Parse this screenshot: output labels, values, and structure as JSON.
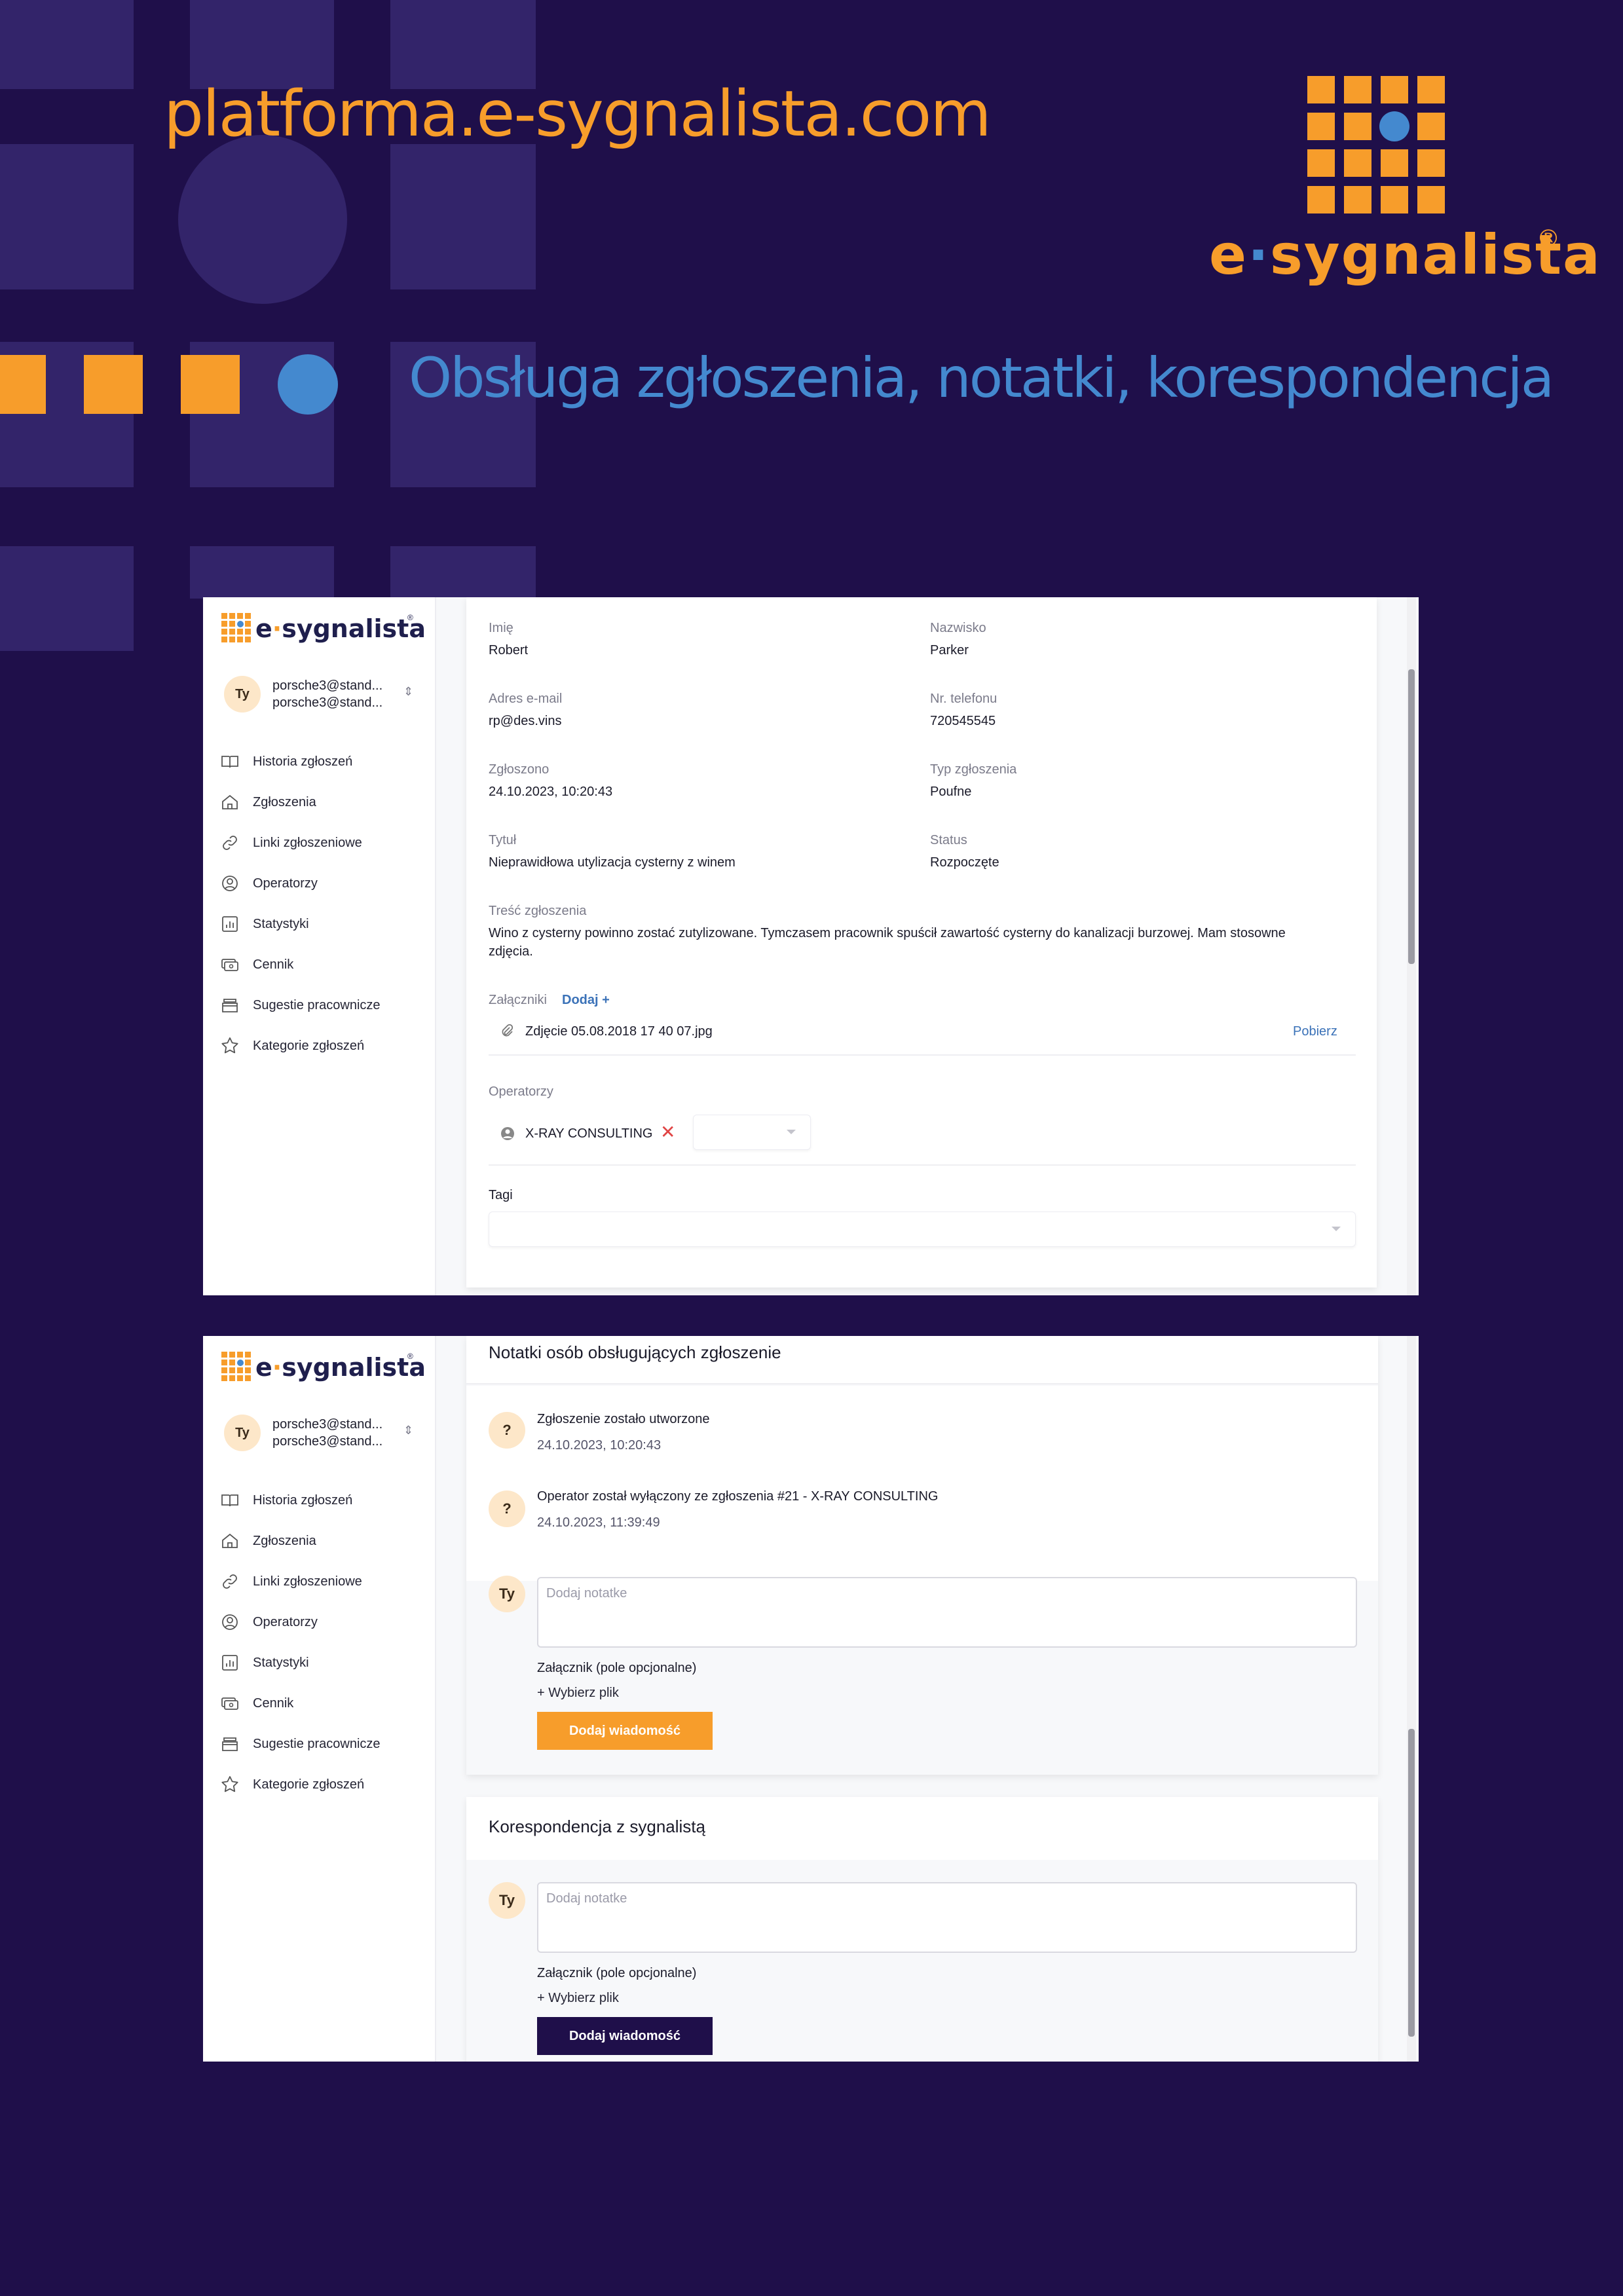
{
  "poster": {
    "url": "platforma.e-sygnalista.com",
    "subtitle": "Obsługa zgłoszenia, notatki, korespondencja",
    "brand_name_pre": "e",
    "brand_name_post": "sygnalista",
    "brand_reg": "®"
  },
  "colors": {
    "background": "#1f0f4a",
    "accent_orange": "#f79d2b",
    "accent_blue": "#4489cf",
    "dark_button": "#1f0f4a"
  },
  "sidebar": {
    "brand_pre": "e",
    "brand_post": "sygnalista",
    "avatar": "Ty",
    "email_1": "porsche3@stand...",
    "email_2": "porsche3@stand...",
    "items": [
      {
        "label": "Historia zgłoszeń",
        "icon": "book-icon"
      },
      {
        "label": "Zgłoszenia",
        "icon": "home-icon"
      },
      {
        "label": "Linki zgłoszeniowe",
        "icon": "link-icon"
      },
      {
        "label": "Operatorzy",
        "icon": "user-circle-icon"
      },
      {
        "label": "Statystyki",
        "icon": "chart-icon"
      },
      {
        "label": "Cennik",
        "icon": "money-icon"
      },
      {
        "label": "Sugestie pracownicze",
        "icon": "inbox-icon"
      },
      {
        "label": "Kategorie zgłoszeń",
        "icon": "star-icon"
      }
    ]
  },
  "report": {
    "first_name_label": "Imię",
    "first_name": "Robert",
    "last_name_label": "Nazwisko",
    "last_name": "Parker",
    "email_label": "Adres e-mail",
    "email": "rp@des.vins",
    "phone_label": "Nr. telefonu",
    "phone": "720545545",
    "reported_label": "Zgłoszono",
    "reported": "24.10.2023, 10:20:43",
    "type_label": "Typ zgłoszenia",
    "type": "Poufne",
    "title_label": "Tytuł",
    "title": "Nieprawidłowa utylizacja cysterny z winem",
    "status_label": "Status",
    "status": "Rozpoczęte",
    "content_label": "Treść zgłoszenia",
    "content_line1": "Wino z cysterny powinno zostać zutylizowane. Tymczasem pracownik spuścił zawartość cysterny do kanalizacji burzowej. Mam stosowne",
    "content_line2": "zdjęcia.",
    "attachments_label": "Załączniki",
    "attachments_add": "Dodaj +",
    "attachment_file": "Zdjęcie 05.08.2018 17 40 07.jpg",
    "attachment_download": "Pobierz",
    "operators_label": "Operatorzy",
    "operator_name": "X-RAY CONSULTING",
    "tags_label": "Tagi"
  },
  "notes": {
    "title": "Notatki osób obsługujących zgłoszenie",
    "entries": [
      {
        "avatar": "?",
        "text": "Zgłoszenie zostało utworzone",
        "date": "24.10.2023, 10:20:43"
      },
      {
        "avatar": "?",
        "text": "Operator został wyłączony ze zgłoszenia #21 - X-RAY CONSULTING",
        "date": "24.10.2023, 11:39:49"
      }
    ],
    "form": {
      "avatar": "Ty",
      "placeholder": "Dodaj notatke",
      "attachment_label": "Załącznik (pole opcjonalne)",
      "pick_file": "+ Wybierz plik",
      "submit": "Dodaj wiadomość"
    }
  },
  "correspondence": {
    "title": "Korespondencja z sygnalistą",
    "form": {
      "avatar": "Ty",
      "placeholder": "Dodaj notatke",
      "attachment_label": "Załącznik (pole opcjonalne)",
      "pick_file": "+ Wybierz plik",
      "submit": "Dodaj wiadomość"
    }
  }
}
